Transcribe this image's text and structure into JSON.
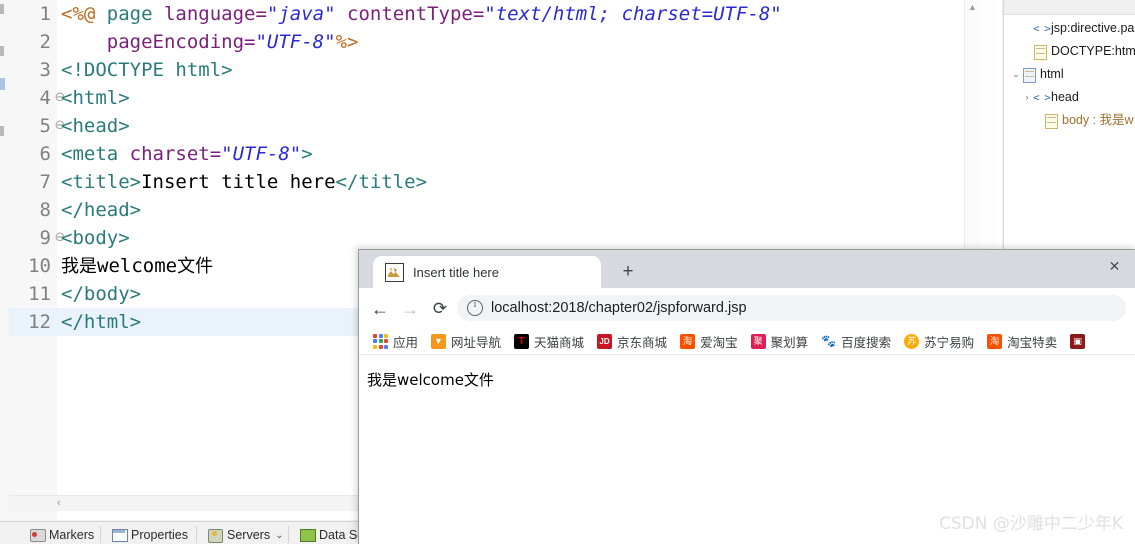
{
  "ide": {
    "editor": {
      "lines": [
        {
          "num": "1",
          "fold": "",
          "tokens": [
            {
              "t": "<%@ ",
              "c": "t-dir"
            },
            {
              "t": "page ",
              "c": "t-tag"
            },
            {
              "t": "language=",
              "c": "t-attr"
            },
            {
              "t": "\"java\"",
              "c": "t-val"
            },
            {
              "t": " ",
              "c": "t-txt"
            },
            {
              "t": "contentType=",
              "c": "t-attr"
            },
            {
              "t": "\"text/html; charset=UTF-8\"",
              "c": "t-val"
            }
          ]
        },
        {
          "num": "2",
          "fold": "",
          "tokens": [
            {
              "t": "    ",
              "c": "t-txt"
            },
            {
              "t": "pageEncoding=",
              "c": "t-attr"
            },
            {
              "t": "\"UTF-8\"",
              "c": "t-val"
            },
            {
              "t": "%>",
              "c": "t-dir"
            }
          ]
        },
        {
          "num": "3",
          "fold": "",
          "tokens": [
            {
              "t": "<!DOCTYPE html>",
              "c": "t-tag"
            }
          ]
        },
        {
          "num": "4",
          "fold": "⊖",
          "tokens": [
            {
              "t": "<html>",
              "c": "t-tag"
            }
          ]
        },
        {
          "num": "5",
          "fold": "⊖",
          "tokens": [
            {
              "t": "<head>",
              "c": "t-tag"
            }
          ]
        },
        {
          "num": "6",
          "fold": "",
          "tokens": [
            {
              "t": "<meta ",
              "c": "t-tag"
            },
            {
              "t": "charset=",
              "c": "t-attr"
            },
            {
              "t": "\"UTF-8\"",
              "c": "t-val"
            },
            {
              "t": ">",
              "c": "t-tag"
            }
          ]
        },
        {
          "num": "7",
          "fold": "",
          "tokens": [
            {
              "t": "<title>",
              "c": "t-tag"
            },
            {
              "t": "Insert title here",
              "c": "t-txt"
            },
            {
              "t": "</title>",
              "c": "t-tag"
            }
          ]
        },
        {
          "num": "8",
          "fold": "",
          "tokens": [
            {
              "t": "</head>",
              "c": "t-tag"
            }
          ]
        },
        {
          "num": "9",
          "fold": "⊖",
          "tokens": [
            {
              "t": "<body>",
              "c": "t-tag"
            }
          ]
        },
        {
          "num": "10",
          "fold": "",
          "tokens": [
            {
              "t": "我是",
              "c": "t-txt t-cjk"
            },
            {
              "t": "welcome",
              "c": "t-txt"
            },
            {
              "t": "文件",
              "c": "t-txt t-cjk"
            }
          ]
        },
        {
          "num": "11",
          "fold": "",
          "tokens": [
            {
              "t": "</body>",
              "c": "t-tag"
            }
          ]
        },
        {
          "num": "12",
          "fold": "",
          "highlight": true,
          "tokens": [
            {
              "t": "</html>",
              "c": "t-tag"
            }
          ]
        }
      ]
    },
    "outline": {
      "nodes": [
        {
          "indent": 1,
          "twist": "",
          "icon": "angle-brackets-icon",
          "label": "jsp:directive.pag",
          "orange": false
        },
        {
          "indent": 1,
          "twist": "",
          "icon": "doctype-icon",
          "label": "DOCTYPE:html",
          "orange": false
        },
        {
          "indent": 0,
          "twist": "⌄",
          "icon": "html-doc-icon",
          "label": "html",
          "orange": false
        },
        {
          "indent": 1,
          "twist": "›",
          "icon": "angle-brackets-icon",
          "label": "head",
          "orange": false
        },
        {
          "indent": 2,
          "twist": "",
          "icon": "body-doc-icon",
          "label": "body : 我是w",
          "orange": true
        }
      ]
    },
    "bottom_tabs": [
      {
        "label": "Markers",
        "icon": "marker-icon",
        "chevron": false
      },
      {
        "label": "Properties",
        "icon": "properties-icon",
        "chevron": false
      },
      {
        "label": "Servers",
        "icon": "server-icon",
        "chevron": true
      },
      {
        "label": "Data Source",
        "icon": "data-source-icon",
        "chevron": false
      }
    ]
  },
  "browser": {
    "tab": {
      "title": "Insert title here",
      "favicon": "broken-image-icon",
      "close_label": "✕"
    },
    "new_tab_label": "+",
    "toolbar": {
      "back_label": "←",
      "forward_label": "→",
      "reload_label": "⟳",
      "url": "localhost:2018/chapter02/jspforward.jsp",
      "security_icon": "info-circle-icon"
    },
    "bookmarks": [
      {
        "label": "应用",
        "icon": "apps-grid-icon",
        "color": "#4285f4"
      },
      {
        "label": "网址导航",
        "icon": "hao123-icon",
        "color": "#f7981d"
      },
      {
        "label": "天猫商城",
        "icon": "tmall-icon",
        "color": "#000000"
      },
      {
        "label": "京东商城",
        "icon": "jd-icon",
        "color": "#c81623"
      },
      {
        "label": "爱淘宝",
        "icon": "taobao-icon",
        "color": "#ff5000"
      },
      {
        "label": "聚划算",
        "icon": "juhuasuan-icon",
        "color": "#e01f54"
      },
      {
        "label": "百度搜索",
        "icon": "baidu-icon",
        "color": "#2932e1"
      },
      {
        "label": "苏宁易购",
        "icon": "suning-icon",
        "color": "#ffaa00"
      },
      {
        "label": "淘宝特卖",
        "icon": "taobao-icon",
        "color": "#ff5000"
      },
      {
        "label": "",
        "icon": "unknown-red-icon",
        "color": "#8b1a1a"
      }
    ],
    "page": {
      "body_text": "我是welcome文件"
    }
  },
  "watermark": "CSDN @沙雕中二少年K"
}
